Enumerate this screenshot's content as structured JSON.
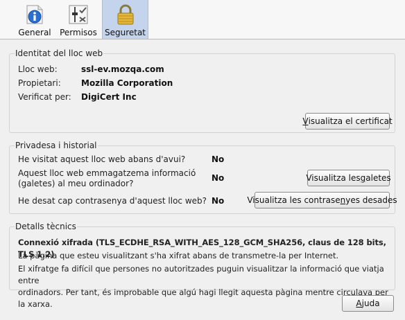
{
  "tabs": [
    {
      "label": "General",
      "icon": "info-icon"
    },
    {
      "label": "Permisos",
      "icon": "permissions-icon"
    },
    {
      "label": "Seguretat",
      "icon": "padlock-icon"
    }
  ],
  "identity": {
    "title": "Identitat del lloc web",
    "rows": [
      {
        "label": "Lloc web:",
        "value": "ssl-ev.mozqa.com"
      },
      {
        "label": "Propietari:",
        "value": "Mozilla Corporation"
      },
      {
        "label": "Verificat per:",
        "value": "DigiCert Inc"
      }
    ],
    "view_cert": {
      "mnemonic": "V",
      "rest": "isualitza el certificat"
    }
  },
  "privacy": {
    "title": "Privadesa i historial",
    "q1": "He visitat aquest lloc web abans d'avui?",
    "a1": "No",
    "q2_line1": "Aquest lloc web emmagatzema informació",
    "q2_line2": "(galetes) al meu ordinador?",
    "a2": "No",
    "view_cookies": {
      "before": "Visualitza les ",
      "mnemonic": "g",
      "after": "aletes"
    },
    "q3": "He desat cap contrasenya d'aquest lloc web?",
    "a3": "No",
    "view_passwords": {
      "before": "Visualitza les contrase",
      "mnemonic": "n",
      "after": "yes desades"
    }
  },
  "technical": {
    "title": "Detalls tècnics",
    "connection": "Connexió xifrada (TLS_ECDHE_RSA_WITH_AES_128_GCM_SHA256, claus de 128 bits, TLS 1.2)",
    "p1": "La pàgina que esteu visualitzant s'ha xifrat abans de transmetre-la per Internet.",
    "p2_line1": "El xifratge fa difícil que persones no autoritzades puguin visualitzar la informació que viatja entre",
    "p2_line2": "ordinadors. Per tant, és improbable que algú hagi llegit aquesta pàgina mentre circulava per la xarxa."
  },
  "help": {
    "mnemonic": "A",
    "rest": "juda"
  }
}
